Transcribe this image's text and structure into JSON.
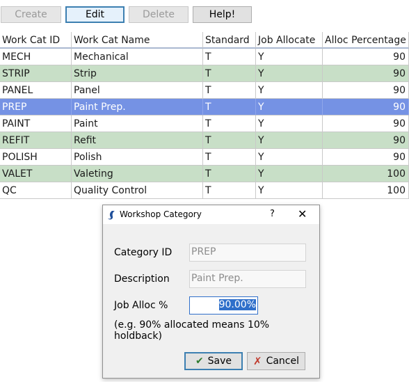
{
  "toolbar": {
    "create_label": "Create",
    "edit_label": "Edit",
    "delete_label": "Delete",
    "help_label": "Help!"
  },
  "grid": {
    "columns": [
      "Work Cat ID",
      "Work Cat Name",
      "Standard",
      "Job Allocate",
      "Alloc Percentage"
    ],
    "rows": [
      [
        "MECH",
        "Mechanical",
        "T",
        "Y",
        "90"
      ],
      [
        "STRIP",
        "Strip",
        "T",
        "Y",
        "90"
      ],
      [
        "PANEL",
        "Panel",
        "T",
        "Y",
        "90"
      ],
      [
        "PREP",
        "Paint Prep.",
        "T",
        "Y",
        "90"
      ],
      [
        "PAINT",
        "Paint",
        "T",
        "Y",
        "90"
      ],
      [
        "REFIT",
        "Refit",
        "T",
        "Y",
        "90"
      ],
      [
        "POLISH",
        "Polish",
        "T",
        "Y",
        "90"
      ],
      [
        "VALET",
        "Valeting",
        "T",
        "Y",
        "100"
      ],
      [
        "QC",
        "Quality Control",
        "T",
        "Y",
        "100"
      ]
    ],
    "selected_row": 3,
    "colors": {
      "odd_row": "#c8dfc7",
      "selected": "#7592e4"
    }
  },
  "dialog": {
    "title": "Workshop Category",
    "help_glyph": "?",
    "close_glyph": "✕",
    "category_id_label": "Category ID",
    "category_id_value": "PREP",
    "description_label": "Description",
    "description_value": "Paint Prep.",
    "job_alloc_label": "Job Alloc %",
    "job_alloc_value": "90.00%",
    "hint": "(e.g. 90% allocated means 10% holdback)",
    "save_label": "Save",
    "cancel_label": "Cancel"
  }
}
